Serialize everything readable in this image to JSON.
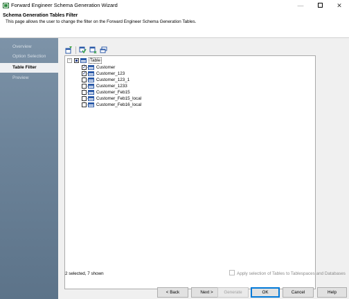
{
  "window": {
    "title": "Forward Engineer Schema Generation Wizard",
    "min_glyph": "—",
    "close_glyph": "✕"
  },
  "header": {
    "title": "Schema Generation Tables Filter",
    "description": "This page allows the user to change the filter on the Forward Engineer Schema Generation Tables."
  },
  "sidebar": {
    "items": [
      {
        "label": "Overview",
        "active": false
      },
      {
        "label": "Option Selection",
        "active": false
      },
      {
        "label": "Table Filter",
        "active": true
      },
      {
        "label": "Preview",
        "active": false
      }
    ]
  },
  "toolbar": {
    "icons": [
      "filter-icon",
      "select-all-icon",
      "deselect-all-icon",
      "expand-collapse-icon"
    ]
  },
  "tree": {
    "root_label": "Table",
    "expander_glyph": "−",
    "items": [
      {
        "label": "Customer",
        "checked": true
      },
      {
        "label": "Customer_123",
        "checked": true
      },
      {
        "label": "Customer_123_1",
        "checked": false
      },
      {
        "label": "Customer_1233",
        "checked": false
      },
      {
        "label": "Customer_Feb15",
        "checked": false
      },
      {
        "label": "Customer_Feb15_local",
        "checked": false
      },
      {
        "label": "Customer_Feb16_local",
        "checked": false
      }
    ]
  },
  "status": {
    "summary": "2 selected, 7 shown",
    "apply_label": "Apply selection of Tables to Tablespaces and Databases",
    "apply_checked": false
  },
  "buttons": {
    "back": "< Back",
    "next": "Next >",
    "generate": "Generate",
    "ok": "OK",
    "cancel": "Cancel",
    "help": "Help"
  }
}
